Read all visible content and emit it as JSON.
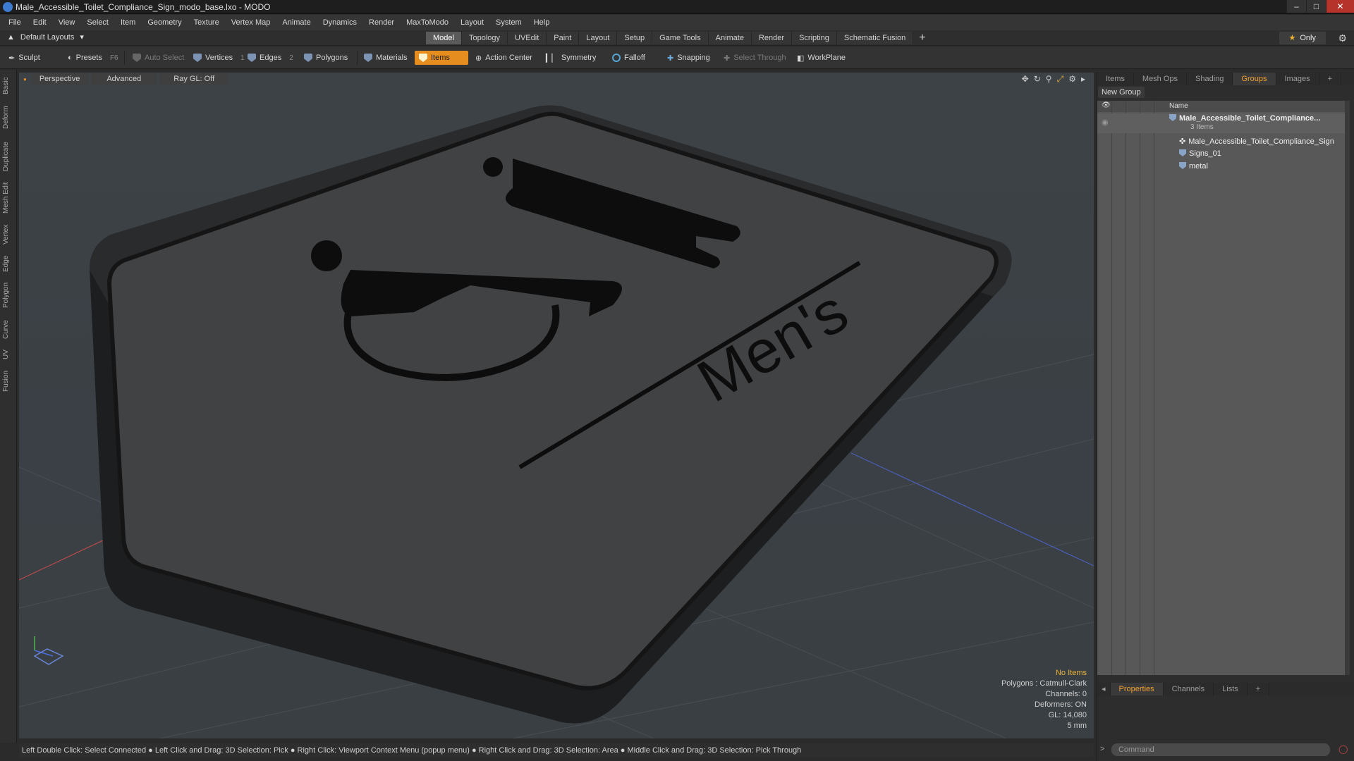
{
  "window": {
    "title": "Male_Accessible_Toilet_Compliance_Sign_modo_base.lxo - MODO",
    "controls": [
      "–",
      "□",
      "✕"
    ]
  },
  "menu": [
    "File",
    "Edit",
    "View",
    "Select",
    "Item",
    "Geometry",
    "Texture",
    "Vertex Map",
    "Animate",
    "Dynamics",
    "Render",
    "MaxToModo",
    "Layout",
    "System",
    "Help"
  ],
  "layoutbar": {
    "dropdown": "Default Layouts",
    "tabs": [
      "Model",
      "Topology",
      "UVEdit",
      "Paint",
      "Layout",
      "Setup",
      "Game Tools",
      "Animate",
      "Render",
      "Scripting",
      "Schematic Fusion"
    ],
    "active_tab": "Model",
    "only_label": "Only"
  },
  "toolbar": {
    "sculpt": "Sculpt",
    "presets": "Presets",
    "presets_key": "F6",
    "auto_select": "Auto Select",
    "vertices": "Vertices",
    "vertices_key": "1",
    "edges": "Edges",
    "edges_key": "2",
    "polygons": "Polygons",
    "materials": "Materials",
    "items": "Items",
    "action_center": "Action Center",
    "symmetry": "Symmetry",
    "falloff": "Falloff",
    "snapping": "Snapping",
    "select_through": "Select Through",
    "workplane": "WorkPlane"
  },
  "left_tabs": [
    "Basic",
    "Deform",
    "Duplicate",
    "Mesh Edit",
    "Vertex",
    "Edge",
    "Polygon",
    "Curve",
    "UV",
    "Fusion"
  ],
  "viewport": {
    "perspective": "Perspective",
    "advanced": "Advanced",
    "raygl": "Ray GL: Off",
    "sign_text": "Men's",
    "info": {
      "no_items": "No Items",
      "polygons": "Polygons : Catmull-Clark",
      "channels": "Channels: 0",
      "deformers": "Deformers: ON",
      "gl": "GL: 14,080",
      "unit": "5 mm"
    }
  },
  "status": "Left Double Click: Select Connected ● Left Click and Drag: 3D Selection: Pick ● Right Click: Viewport Context Menu (popup menu) ● Right Click and Drag: 3D Selection: Area ● Middle Click and Drag: 3D Selection: Pick Through",
  "right_panel": {
    "tabs": [
      "Items",
      "Mesh Ops",
      "Shading",
      "Groups",
      "Images"
    ],
    "active_tab": "Groups",
    "new_group": "New Group",
    "name_header": "Name",
    "group_name": "Male_Accessible_Toilet_Compliance...",
    "group_count": "3 Items",
    "children": [
      "Male_Accessible_Toilet_Compliance_Sign",
      "Signs_01",
      "metal"
    ],
    "bottom_tabs": [
      "Properties",
      "Channels",
      "Lists"
    ],
    "active_bottom": "Properties",
    "command_placeholder": "Command"
  },
  "colors": {
    "accent": "#e58d1f",
    "tab_active": "#f0a030",
    "info_highlight": "#e8b33b"
  }
}
